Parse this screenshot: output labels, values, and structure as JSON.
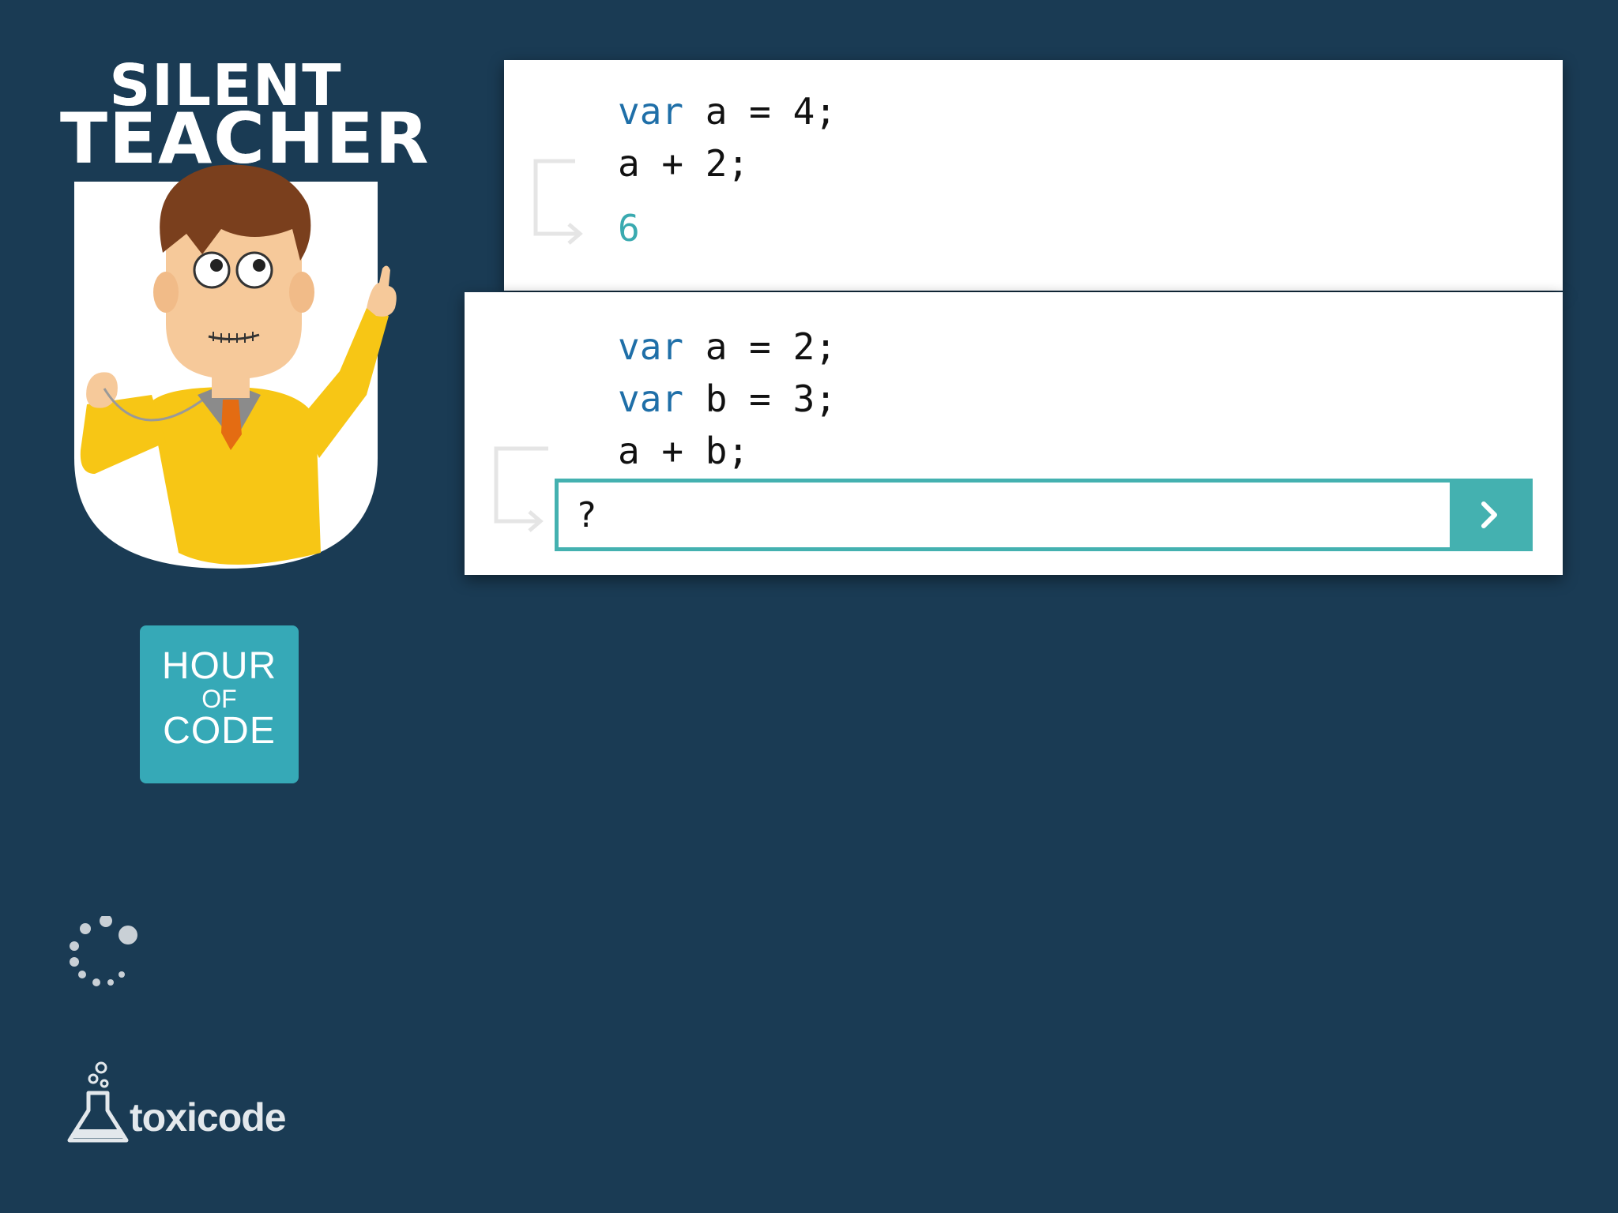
{
  "logo": {
    "line1": "SILENT",
    "line2": "TEACHER"
  },
  "hour_of_code": {
    "line1": "HOUR",
    "line2": "OF",
    "line3": "CODE"
  },
  "previous_exercise": {
    "code": [
      {
        "kw": "var",
        "rest": " a = 4;"
      },
      {
        "kw": "",
        "rest": "a + 2;"
      }
    ],
    "result": "6"
  },
  "current_exercise": {
    "code": [
      {
        "kw": "var",
        "rest": " a = 2;"
      },
      {
        "kw": "var",
        "rest": " b = 3;"
      },
      {
        "kw": "",
        "rest": "a + b;"
      }
    ],
    "answer_placeholder": "?"
  },
  "brand": {
    "name": "toxicode"
  },
  "colors": {
    "background": "#1a3b54",
    "accent": "#44b1b0",
    "keyword": "#1f6fa8",
    "hour_of_code_bg": "#36a9b7"
  },
  "icons": {
    "submit": "chevron-right-icon",
    "spinner": "loading-spinner-icon",
    "flask": "flask-icon"
  }
}
